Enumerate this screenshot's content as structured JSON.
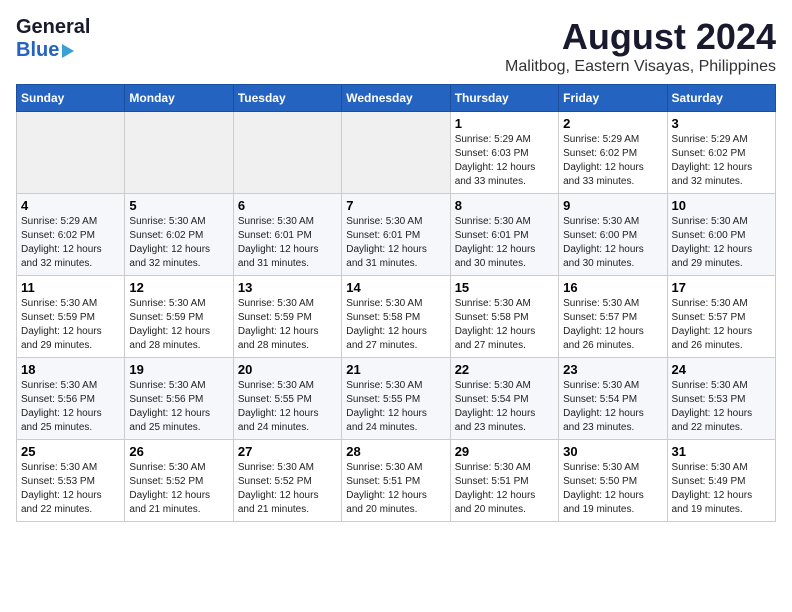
{
  "header": {
    "logo_general": "General",
    "logo_blue": "Blue",
    "main_title": "August 2024",
    "subtitle": "Malitbog, Eastern Visayas, Philippines"
  },
  "calendar": {
    "days_of_week": [
      "Sunday",
      "Monday",
      "Tuesday",
      "Wednesday",
      "Thursday",
      "Friday",
      "Saturday"
    ],
    "weeks": [
      [
        {
          "day": "",
          "info": ""
        },
        {
          "day": "",
          "info": ""
        },
        {
          "day": "",
          "info": ""
        },
        {
          "day": "",
          "info": ""
        },
        {
          "day": "1",
          "info": "Sunrise: 5:29 AM\nSunset: 6:03 PM\nDaylight: 12 hours\nand 33 minutes."
        },
        {
          "day": "2",
          "info": "Sunrise: 5:29 AM\nSunset: 6:02 PM\nDaylight: 12 hours\nand 33 minutes."
        },
        {
          "day": "3",
          "info": "Sunrise: 5:29 AM\nSunset: 6:02 PM\nDaylight: 12 hours\nand 32 minutes."
        }
      ],
      [
        {
          "day": "4",
          "info": "Sunrise: 5:29 AM\nSunset: 6:02 PM\nDaylight: 12 hours\nand 32 minutes."
        },
        {
          "day": "5",
          "info": "Sunrise: 5:30 AM\nSunset: 6:02 PM\nDaylight: 12 hours\nand 32 minutes."
        },
        {
          "day": "6",
          "info": "Sunrise: 5:30 AM\nSunset: 6:01 PM\nDaylight: 12 hours\nand 31 minutes."
        },
        {
          "day": "7",
          "info": "Sunrise: 5:30 AM\nSunset: 6:01 PM\nDaylight: 12 hours\nand 31 minutes."
        },
        {
          "day": "8",
          "info": "Sunrise: 5:30 AM\nSunset: 6:01 PM\nDaylight: 12 hours\nand 30 minutes."
        },
        {
          "day": "9",
          "info": "Sunrise: 5:30 AM\nSunset: 6:00 PM\nDaylight: 12 hours\nand 30 minutes."
        },
        {
          "day": "10",
          "info": "Sunrise: 5:30 AM\nSunset: 6:00 PM\nDaylight: 12 hours\nand 29 minutes."
        }
      ],
      [
        {
          "day": "11",
          "info": "Sunrise: 5:30 AM\nSunset: 5:59 PM\nDaylight: 12 hours\nand 29 minutes."
        },
        {
          "day": "12",
          "info": "Sunrise: 5:30 AM\nSunset: 5:59 PM\nDaylight: 12 hours\nand 28 minutes."
        },
        {
          "day": "13",
          "info": "Sunrise: 5:30 AM\nSunset: 5:59 PM\nDaylight: 12 hours\nand 28 minutes."
        },
        {
          "day": "14",
          "info": "Sunrise: 5:30 AM\nSunset: 5:58 PM\nDaylight: 12 hours\nand 27 minutes."
        },
        {
          "day": "15",
          "info": "Sunrise: 5:30 AM\nSunset: 5:58 PM\nDaylight: 12 hours\nand 27 minutes."
        },
        {
          "day": "16",
          "info": "Sunrise: 5:30 AM\nSunset: 5:57 PM\nDaylight: 12 hours\nand 26 minutes."
        },
        {
          "day": "17",
          "info": "Sunrise: 5:30 AM\nSunset: 5:57 PM\nDaylight: 12 hours\nand 26 minutes."
        }
      ],
      [
        {
          "day": "18",
          "info": "Sunrise: 5:30 AM\nSunset: 5:56 PM\nDaylight: 12 hours\nand 25 minutes."
        },
        {
          "day": "19",
          "info": "Sunrise: 5:30 AM\nSunset: 5:56 PM\nDaylight: 12 hours\nand 25 minutes."
        },
        {
          "day": "20",
          "info": "Sunrise: 5:30 AM\nSunset: 5:55 PM\nDaylight: 12 hours\nand 24 minutes."
        },
        {
          "day": "21",
          "info": "Sunrise: 5:30 AM\nSunset: 5:55 PM\nDaylight: 12 hours\nand 24 minutes."
        },
        {
          "day": "22",
          "info": "Sunrise: 5:30 AM\nSunset: 5:54 PM\nDaylight: 12 hours\nand 23 minutes."
        },
        {
          "day": "23",
          "info": "Sunrise: 5:30 AM\nSunset: 5:54 PM\nDaylight: 12 hours\nand 23 minutes."
        },
        {
          "day": "24",
          "info": "Sunrise: 5:30 AM\nSunset: 5:53 PM\nDaylight: 12 hours\nand 22 minutes."
        }
      ],
      [
        {
          "day": "25",
          "info": "Sunrise: 5:30 AM\nSunset: 5:53 PM\nDaylight: 12 hours\nand 22 minutes."
        },
        {
          "day": "26",
          "info": "Sunrise: 5:30 AM\nSunset: 5:52 PM\nDaylight: 12 hours\nand 21 minutes."
        },
        {
          "day": "27",
          "info": "Sunrise: 5:30 AM\nSunset: 5:52 PM\nDaylight: 12 hours\nand 21 minutes."
        },
        {
          "day": "28",
          "info": "Sunrise: 5:30 AM\nSunset: 5:51 PM\nDaylight: 12 hours\nand 20 minutes."
        },
        {
          "day": "29",
          "info": "Sunrise: 5:30 AM\nSunset: 5:51 PM\nDaylight: 12 hours\nand 20 minutes."
        },
        {
          "day": "30",
          "info": "Sunrise: 5:30 AM\nSunset: 5:50 PM\nDaylight: 12 hours\nand 19 minutes."
        },
        {
          "day": "31",
          "info": "Sunrise: 5:30 AM\nSunset: 5:49 PM\nDaylight: 12 hours\nand 19 minutes."
        }
      ]
    ]
  }
}
